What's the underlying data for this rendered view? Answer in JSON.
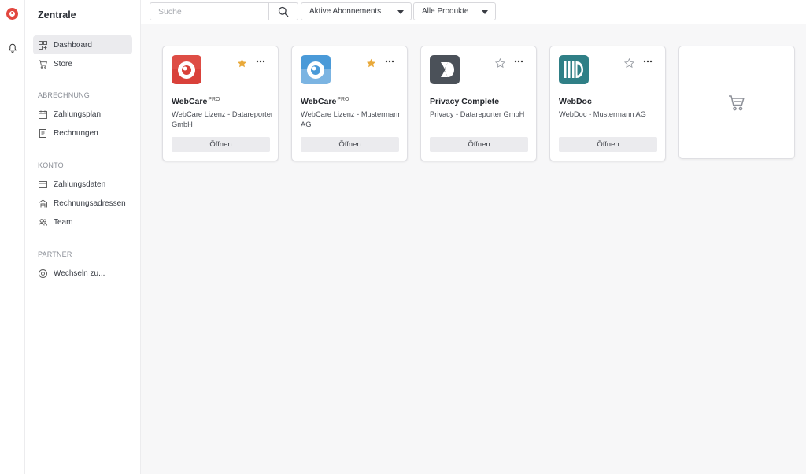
{
  "app": {
    "title": "Zentrale"
  },
  "rail": {
    "logo_icon": "webcare-logo-icon",
    "bell_icon": "bell-icon"
  },
  "sidebar": {
    "items": [
      {
        "label": "Dashboard",
        "icon": "grid-icon",
        "active": true
      },
      {
        "label": "Store",
        "icon": "cart-icon",
        "active": false
      }
    ],
    "sections": [
      {
        "title": "ABRECHNUNG",
        "items": [
          {
            "label": "Zahlungsplan",
            "icon": "calendar-icon"
          },
          {
            "label": "Rechnungen",
            "icon": "invoice-icon"
          }
        ]
      },
      {
        "title": "KONTO",
        "items": [
          {
            "label": "Zahlungsdaten",
            "icon": "credit-card-icon"
          },
          {
            "label": "Rechnungsadressen",
            "icon": "building-icon"
          },
          {
            "label": "Team",
            "icon": "users-icon"
          }
        ]
      },
      {
        "title": "PARTNER",
        "items": [
          {
            "label": "Wechseln zu...",
            "icon": "switch-icon"
          }
        ]
      }
    ]
  },
  "toolbar": {
    "search_placeholder": "Suche",
    "search_value": "",
    "filter_subscriptions": "Aktive Abonnements",
    "filter_products": "Alle Produkte"
  },
  "cards": [
    {
      "name": "WebCare",
      "badge": "PRO",
      "subtitle": "WebCare Lizenz - Datareporter GmbH",
      "favorite": true,
      "button": "Öffnen",
      "icon_color": "#d9413a"
    },
    {
      "name": "WebCare",
      "badge": "PRO",
      "subtitle": "WebCare Lizenz - Mustermann AG",
      "favorite": true,
      "button": "Öffnen",
      "icon_color": "#4a9ad8"
    },
    {
      "name": "Privacy Complete",
      "badge": "",
      "subtitle": "Privacy - Datareporter GmbH",
      "favorite": false,
      "button": "Öffnen",
      "icon_color": "#4b5159"
    },
    {
      "name": "WebDoc",
      "badge": "",
      "subtitle": "WebDoc - Mustermann AG",
      "favorite": false,
      "button": "Öffnen",
      "icon_color": "#2f7f86"
    }
  ],
  "store_card": {
    "icon": "cart-icon"
  },
  "colors": {
    "star": "#e9a93a",
    "active_item": "#ebebee"
  }
}
